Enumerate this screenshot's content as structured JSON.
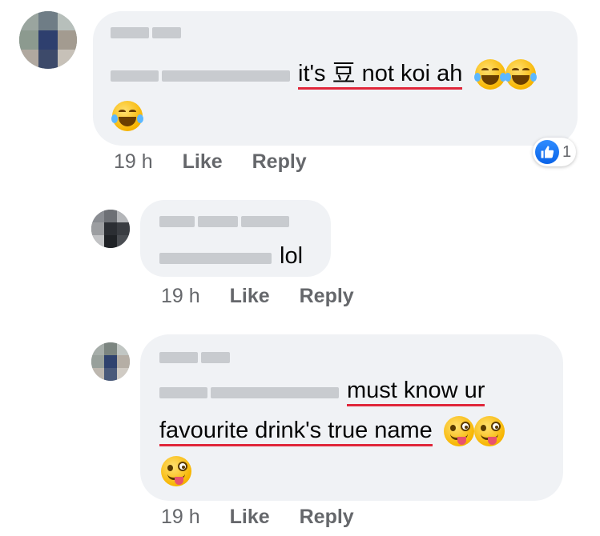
{
  "comments": [
    {
      "text_before": "it's 豆 not koi ah",
      "emojis_inline": [
        "tears-of-joy",
        "tears-of-joy"
      ],
      "emojis_next_line": [
        "tears-of-joy"
      ],
      "time": "19 h",
      "like_label": "Like",
      "reply_label": "Reply",
      "reaction_count": "1"
    },
    {
      "text": "lol",
      "time": "19 h",
      "like_label": "Like",
      "reply_label": "Reply"
    },
    {
      "text_line1": "must know ur",
      "text_line2": "favourite drink's true name",
      "emojis_inline": [
        "winking-tongue",
        "winking-tongue"
      ],
      "emojis_next_line": [
        "winking-tongue"
      ],
      "time": "19 h",
      "like_label": "Like",
      "reply_label": "Reply"
    }
  ],
  "icons": {
    "reaction": "thumbs-up-icon",
    "emoji_joy": "tears-of-joy-emoji",
    "emoji_tongue": "winking-tongue-emoji"
  },
  "colors": {
    "bubble": "#f0f2f5",
    "underline": "#e0263a",
    "meta": "#65676b",
    "like_blue": "#1877f2"
  }
}
